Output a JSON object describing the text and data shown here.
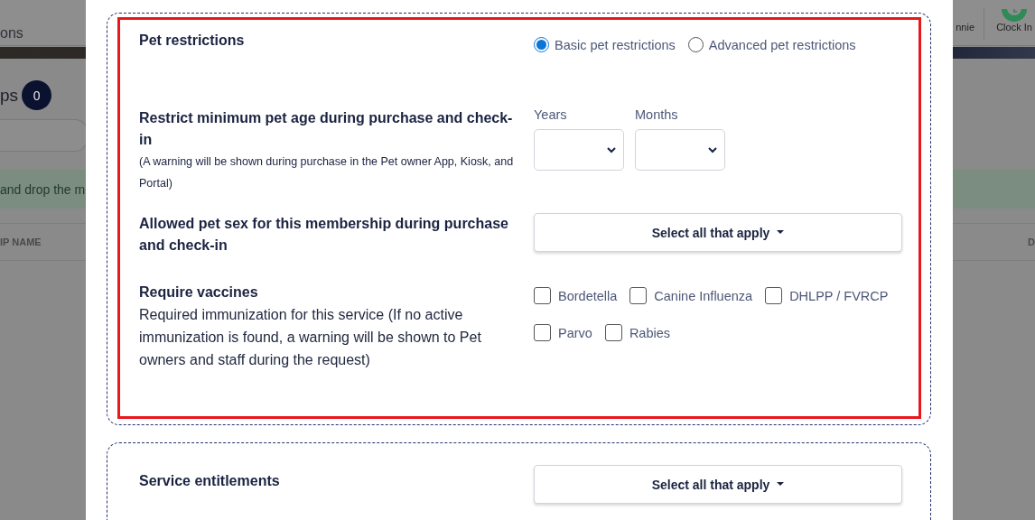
{
  "background": {
    "header_text": "ons",
    "user_name": "nnie",
    "clock_in": "Clock In",
    "heading": "ps",
    "count_badge": "0",
    "notice": "and drop the m",
    "column_1": "IP NAME",
    "column_2": "D"
  },
  "sections": [
    {
      "kind": "pet",
      "highlighted": true,
      "title": "Pet restrictions",
      "mode_options": [
        {
          "label": "Basic pet restrictions",
          "selected": true
        },
        {
          "label": "Advanced pet restrictions",
          "selected": false
        }
      ],
      "age": {
        "label": "Restrict minimum pet age during purchase and check-in",
        "note": "(A warning will be shown during purchase in the Pet owner App, Kiosk, and Portal)",
        "fields": [
          {
            "label": "Years"
          },
          {
            "label": "Months"
          }
        ]
      },
      "sex": {
        "label": "Allowed pet sex for this membership during purchase and check-in",
        "button": "Select all that apply"
      },
      "vaccines": {
        "label": "Require vaccines",
        "description": "Required immunization for this service (If no active immunization is found, a warning will be shown to Pet owners and staff during the request)",
        "options": [
          {
            "label": "Bordetella",
            "checked": false
          },
          {
            "label": "Canine Influenza",
            "checked": false
          },
          {
            "label": "DHLPP / FVRCP",
            "checked": false
          },
          {
            "label": "Parvo",
            "checked": false
          },
          {
            "label": "Rabies",
            "checked": false
          }
        ]
      }
    },
    {
      "kind": "entitlements",
      "highlighted": false,
      "title": "Service entitlements",
      "button": "Select all that apply"
    }
  ]
}
